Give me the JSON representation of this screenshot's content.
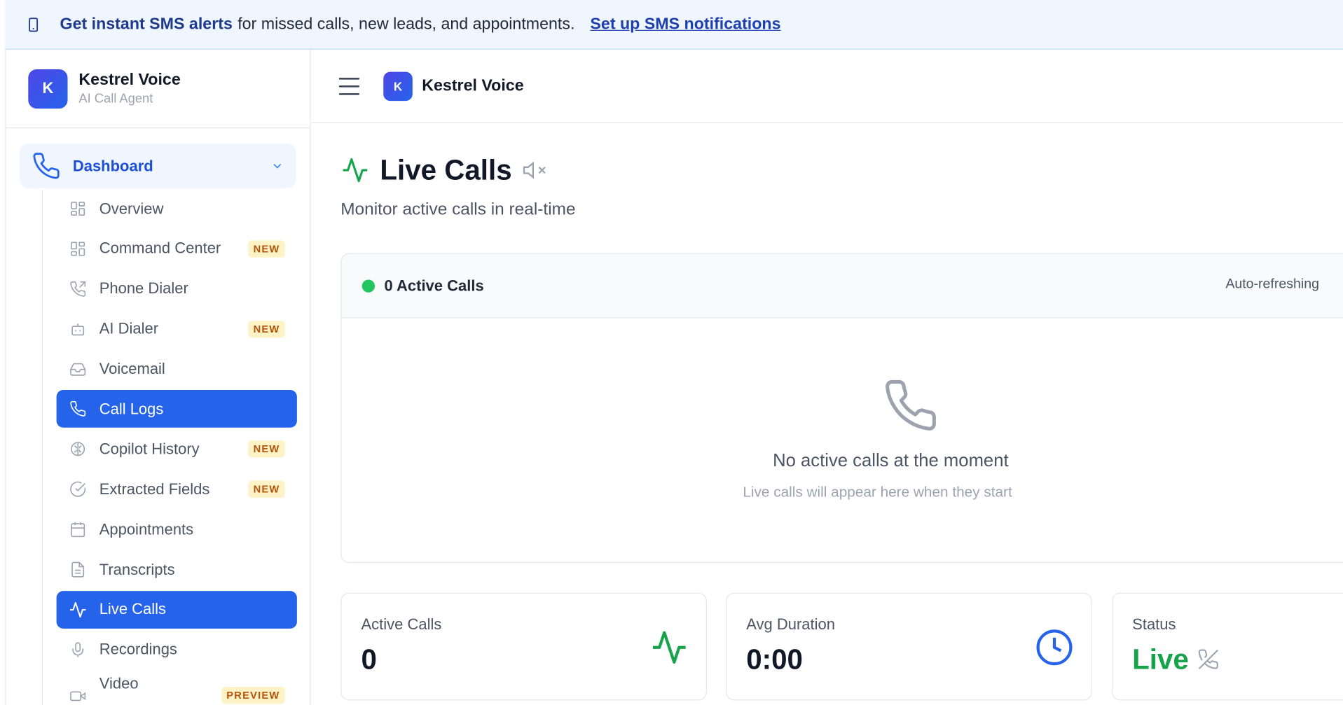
{
  "banner": {
    "icon": "phone-mobile-icon",
    "bold": "Get instant SMS alerts",
    "text": "for missed calls, new leads, and appointments.",
    "link": "Set up SMS notifications"
  },
  "sidebar": {
    "brand_initial": "K",
    "brand_name": "Kestrel Voice",
    "brand_subtitle": "AI Call Agent",
    "section": {
      "label": "Dashboard",
      "icon": "phone-icon"
    },
    "items": [
      {
        "label": "Overview",
        "icon": "grid-icon",
        "badge": ""
      },
      {
        "label": "Command Center",
        "icon": "grid-icon",
        "badge": "NEW"
      },
      {
        "label": "Phone Dialer",
        "icon": "phone-outgoing-icon",
        "badge": ""
      },
      {
        "label": "AI Dialer",
        "icon": "bot-icon",
        "badge": "NEW"
      },
      {
        "label": "Voicemail",
        "icon": "inbox-icon",
        "badge": ""
      },
      {
        "label": "Call Logs",
        "icon": "phone-icon",
        "badge": "",
        "active": true
      },
      {
        "label": "Copilot History",
        "icon": "brain-icon",
        "badge": "NEW"
      },
      {
        "label": "Extracted Fields",
        "icon": "check-circle-icon",
        "badge": "NEW"
      },
      {
        "label": "Appointments",
        "icon": "calendar-icon",
        "badge": ""
      },
      {
        "label": "Transcripts",
        "icon": "file-text-icon",
        "badge": ""
      },
      {
        "label": "Live Calls",
        "icon": "activity-icon",
        "badge": "",
        "active": true
      },
      {
        "label": "Recordings",
        "icon": "mic-icon",
        "badge": ""
      },
      {
        "label": "Video",
        "icon": "video-icon",
        "badge": "PREVIEW"
      }
    ]
  },
  "topbar": {
    "initial": "K",
    "name": "Kestrel Voice"
  },
  "main": {
    "title": "Live Calls",
    "subtitle": "Monitor active calls in real-time",
    "panel": {
      "count_label": "0 Active Calls",
      "auto_label": "Auto-refreshing",
      "empty_title": "No active calls at the moment",
      "empty_sub": "Live calls will appear here when they start"
    },
    "cards": [
      {
        "label": "Active Calls",
        "value": "0",
        "icon": "activity-icon",
        "color": "#16a34a"
      },
      {
        "label": "Avg Duration",
        "value": "0:00",
        "icon": "clock-icon",
        "color": "#2563eb"
      },
      {
        "label": "Status",
        "value": "Live",
        "icon": "phone-off-icon",
        "color": "#16a34a"
      }
    ]
  },
  "colors": {
    "primary": "#2563eb",
    "success": "#16a34a",
    "badge_bg": "#fef3c7",
    "badge_fg": "#b45309"
  }
}
